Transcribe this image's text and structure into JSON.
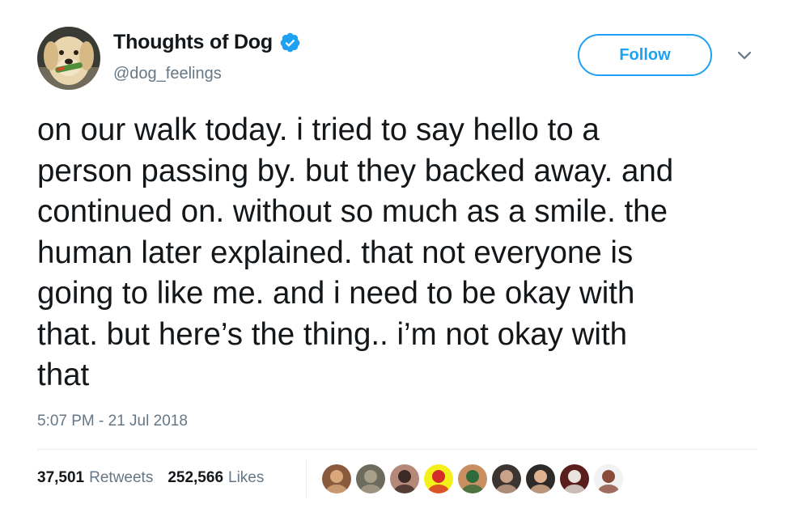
{
  "account": {
    "display_name": "Thoughts of Dog",
    "handle": "@dog_feelings",
    "verified": true,
    "avatar_icon": "dog-avatar"
  },
  "follow_button": {
    "label": "Follow"
  },
  "menu_icon": "chevron-down-icon",
  "tweet": {
    "lines": [
      "on our walk today. i tried to say hello to a",
      "person passing by. but they backed away. and",
      "continued on. without so much as a smile. the",
      "human later explained. that not everyone is",
      "going to like me. and i need to be okay with",
      "that. but here’s the thing.. i’m not okay with",
      "that"
    ],
    "timestamp": "5:07 PM - 21 Jul 2018"
  },
  "stats": {
    "retweets_count": "37,501",
    "retweets_label": "Retweets",
    "likes_count": "252,566",
    "likes_label": "Likes"
  },
  "likers": [
    {
      "color": "#8a5a3c",
      "accent": "#d9a77a"
    },
    {
      "color": "#6d6a5e",
      "accent": "#a89f8a"
    },
    {
      "color": "#b5887a",
      "accent": "#3b2a26"
    },
    {
      "color": "#f4f01c",
      "accent": "#d62b2b"
    },
    {
      "color": "#c98f62",
      "accent": "#2f6b3a"
    },
    {
      "color": "#3c3430",
      "accent": "#c9a28b"
    },
    {
      "color": "#2d2a2a",
      "accent": "#e0b18f"
    },
    {
      "color": "#5a1f1c",
      "accent": "#e8e3de"
    },
    {
      "color": "#f2f2f2",
      "accent": "#8a4a3a"
    }
  ],
  "colors": {
    "brand_blue": "#1da1f2",
    "text_primary": "#14171a",
    "text_secondary": "#657786",
    "divider": "#e6ecf0"
  }
}
